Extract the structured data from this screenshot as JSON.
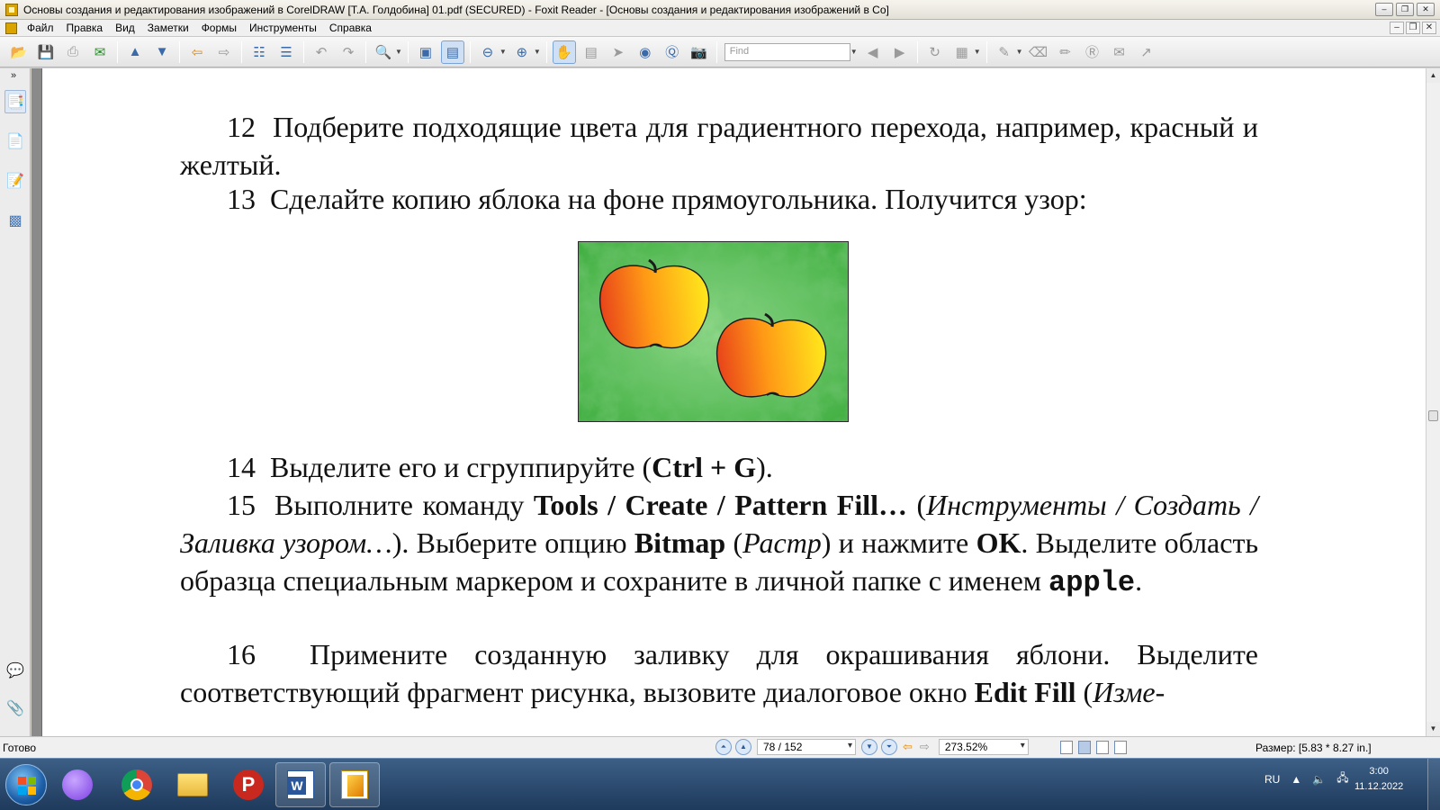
{
  "window": {
    "title": "Основы создания и редактирования изображений в CorelDRAW [Т.А. Голдобина] 01.pdf (SECURED) - Foxit Reader - [Основы создания и редактирования изображений в Co]",
    "controls": [
      "–",
      "❐",
      "✕"
    ]
  },
  "menu": {
    "items": [
      "Файл",
      "Правка",
      "Вид",
      "Заметки",
      "Формы",
      "Инструменты",
      "Справка"
    ],
    "mdi_controls": [
      "–",
      "❐",
      "✕"
    ]
  },
  "toolbar": {
    "find_placeholder": "Find"
  },
  "document": {
    "p12_num": "12",
    "p12_text": "Подберите подходящие цвета для градиентного перехода, например, красный и желтый.",
    "p13_num": "13",
    "p13_text": "Сделайте копию яблока на фоне прямоугольника. Получится узор:",
    "p14_num": "14",
    "p14_a": "Выделите его и сгруппируйте (",
    "p14_keys": "Ctrl + G",
    "p14_b": ").",
    "p15_num": "15",
    "p15_a": "Выполните команду ",
    "p15_cmd": "Tools / Create / Pattern Fill…",
    "p15_b": " (",
    "p15_cmd_ru": "Инструменты / Создать / Заливка узором…",
    "p15_c": "). Выберите опцию ",
    "p15_bitmap": "Bitmap",
    "p15_d": " (",
    "p15_bitmap_ru": "Растр",
    "p15_e": ") и нажмите ",
    "p15_ok": "OK",
    "p15_f": ". Выделите область образца специальным маркером и сохраните в личной папке с именем ",
    "p15_name": "apple",
    "p15_g": ".",
    "p16_num": "16",
    "p16_a": "Примените созданную заливку для окрашивания яблони. Выделите соответствующий фрагмент рисунка, вызовите диалоговое окно ",
    "p16_cmd": "Edit Fill",
    "p16_b": " (",
    "p16_cmd_ru": "Изме-"
  },
  "statusbar": {
    "ready": "Готово",
    "page": "78 / 152",
    "zoom": "273.52%",
    "size": "Размер: [5.83 * 8.27 in.]"
  },
  "taskbar": {
    "lang": "RU",
    "time": "3:00",
    "date": "11.12.2022"
  },
  "colors": {
    "apple_red": "#e8431a",
    "apple_yellow": "#ffe81c",
    "pattern_green": "#3fae3f"
  }
}
